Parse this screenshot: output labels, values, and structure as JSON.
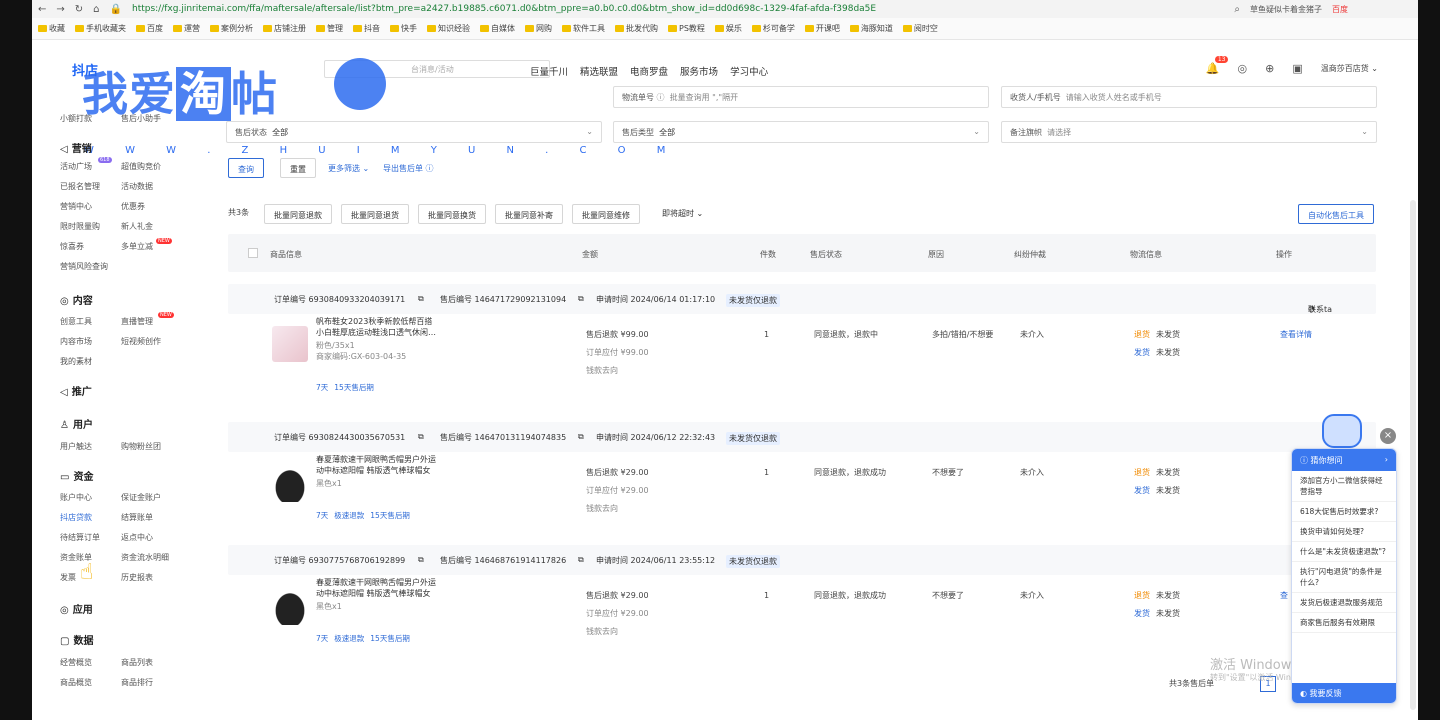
{
  "browser": {
    "url": "https://fxg.jinritemai.com/ffa/maftersale/aftersale/list?btm_pre=a2427.b19885.c6071.d0&btm_ppre=a0.b0.c0.d0&btm_show_id=dd0d698c-1329-4faf-afda-f398da5E",
    "search": "草鱼疑似卡着金猪子",
    "search_badge": "百度",
    "bookmarks": [
      "收藏",
      "手机收藏夹",
      "百度",
      "運营",
      "案例分析",
      "店铺注册",
      "管理",
      "抖音",
      "快手",
      "知识经验",
      "自媒体",
      "网购",
      "软件工具",
      "批发代购",
      "PS教程",
      "娱乐",
      "杉可备学",
      "开课吧",
      "海豚知道",
      "阅时空"
    ]
  },
  "header": {
    "logo": "抖店",
    "search_placeholder": "台消息/活动",
    "nav": [
      "巨量千川",
      "精选联盟",
      "电商罗盘",
      "服务市场",
      "学习中心"
    ],
    "notif_count": "13",
    "shop": "温商莎百店货"
  },
  "watermark": {
    "text1": "我爱",
    "text2": "淘",
    "text3": "帖",
    "sub": "W W W . Z H U I M Y U N . C O M"
  },
  "sidebar": {
    "top": [
      "小额打款",
      "售后小助手"
    ],
    "marketing": {
      "title": "营销",
      "items": [
        "活动广场",
        "超值购竞价",
        "已报名管理",
        "活动数据",
        "营销中心",
        "优惠券",
        "限时限量购",
        "新人礼金",
        "惊喜券",
        "多单立减",
        "营销风险查询"
      ],
      "badge": "618"
    },
    "content": {
      "title": "内容",
      "items": [
        "创意工具",
        "直播管理",
        "内容市场",
        "短视频创作",
        "我的素材"
      ]
    },
    "promo": {
      "title": "推广"
    },
    "user": {
      "title": "用户",
      "items": [
        "用户触达",
        "购物粉丝团"
      ]
    },
    "funds": {
      "title": "资金",
      "items": [
        "账户中心",
        "保证金账户",
        "抖店贷款",
        "结算账单",
        "待结算订单",
        "返点中心",
        "资金账单",
        "资金流水明细",
        "发票",
        "历史报表"
      ]
    },
    "apps": {
      "title": "应用"
    },
    "data": {
      "title": "数据",
      "items": [
        "经营概览",
        "商品列表",
        "商品概览",
        "商品排行"
      ]
    },
    "new_label": "NEW"
  },
  "filters": {
    "logistics_no": "物流单号",
    "logistics_ph": "批量查询用 \",\"隔开",
    "receiver": "收货人/手机号",
    "receiver_ph": "请输入收货人姓名或手机号",
    "status_label": "售后状态",
    "status_val": "全部",
    "type_label": "售后类型",
    "type_val": "全部",
    "note_label": "备注旗帜",
    "note_ph": "请选择"
  },
  "actions": {
    "query": "查询",
    "reset": "重置",
    "more": "更多筛选",
    "export": "导出售后单",
    "count": "共3条",
    "batch": [
      "批量同意退款",
      "批量同意退货",
      "批量同意换货",
      "批量同意补寄",
      "批量同意维修"
    ],
    "timeout": "即将超时",
    "auto": "自动化售后工具"
  },
  "table": {
    "headers": [
      "商品信息",
      "金额",
      "件数",
      "售后状态",
      "原因",
      "纠纷仲裁",
      "物流信息",
      "操作"
    ]
  },
  "orders": [
    {
      "order_no": "订单编号 6930840933204039171",
      "aftersale_no": "售后编号 146471729092131094",
      "apply_time": "申请时间 2024/06/14 01:17:10",
      "tag": "未发货仅退款",
      "title1": "帆布鞋女2023秋季新款低帮百搭",
      "title2": "小白鞋厚底运动鞋浅口透气休闲…",
      "spec": "粉色/35x1",
      "code": "商家编码:GX-603-04-35",
      "chips": [
        "7天",
        "15天售后期"
      ],
      "refund": "售后退款 ¥99.00",
      "payable": "订单应付 ¥99.00",
      "flow": "钱款去向",
      "qty": "1",
      "status": "同意退款，退款中",
      "reason": "多拍/错拍/不想要",
      "dispute": "未介入",
      "return_ship": "退货",
      "return_state": "未发货",
      "send_ship": "发货",
      "send_state": "未发货",
      "op": "查看详情",
      "contact": "联系ta"
    },
    {
      "order_no": "订单编号 6930824430035670531",
      "aftersale_no": "售后编号 146470131194074835",
      "apply_time": "申请时间 2024/06/12 22:32:43",
      "tag": "未发货仅退款",
      "title1": "春夏薄款速干网眼鸭舌帽男户外运",
      "title2": "动中标遮阳帽 韩版透气棒球帽女",
      "spec": "黑色x1",
      "code": "",
      "chips": [
        "7天",
        "极速退款",
        "15天售后期"
      ],
      "refund": "售后退款 ¥29.00",
      "payable": "订单应付 ¥29.00",
      "flow": "钱款去向",
      "qty": "1",
      "status": "同意退款，退款成功",
      "reason": "不想要了",
      "dispute": "未介入",
      "return_ship": "退货",
      "return_state": "未发货",
      "send_ship": "发货",
      "send_state": "未发货",
      "op": "",
      "contact": ""
    },
    {
      "order_no": "订单编号 6930775768706192899",
      "aftersale_no": "售后编号 146468761914117826",
      "apply_time": "申请时间 2024/06/11 23:55:12",
      "tag": "未发货仅退款",
      "title1": "春夏薄款速干网眼鸭舌帽男户外运",
      "title2": "动中标遮阳帽 韩版透气棒球帽女",
      "spec": "黑色x1",
      "code": "",
      "chips": [
        "7天",
        "极速退款",
        "15天售后期"
      ],
      "refund": "售后退款 ¥29.00",
      "payable": "订单应付 ¥29.00",
      "flow": "钱款去向",
      "qty": "1",
      "status": "同意退款，退款成功",
      "reason": "不想要了",
      "dispute": "未介入",
      "return_ship": "退货",
      "return_state": "未发货",
      "send_ship": "发货",
      "send_state": "未发货",
      "op": "查",
      "contact": ""
    }
  ],
  "footer": {
    "total": "共3条售后单",
    "page": "1"
  },
  "help": {
    "title": "猜你想问",
    "questions": [
      "添加官方小二微信获得经营指导",
      "618大促售后时效要求?",
      "换货申请如何处理?",
      "什么是\"未发货极速退款\"?",
      "执行\"闪电退货\"的条件是什么?",
      "发货后极速退款服务规范",
      "商家售后服务有效期限"
    ],
    "feedback": "我要反馈"
  },
  "windows": {
    "line1": "激活 Windows",
    "line2": "转到\"设置\"以激活 Windows。"
  }
}
